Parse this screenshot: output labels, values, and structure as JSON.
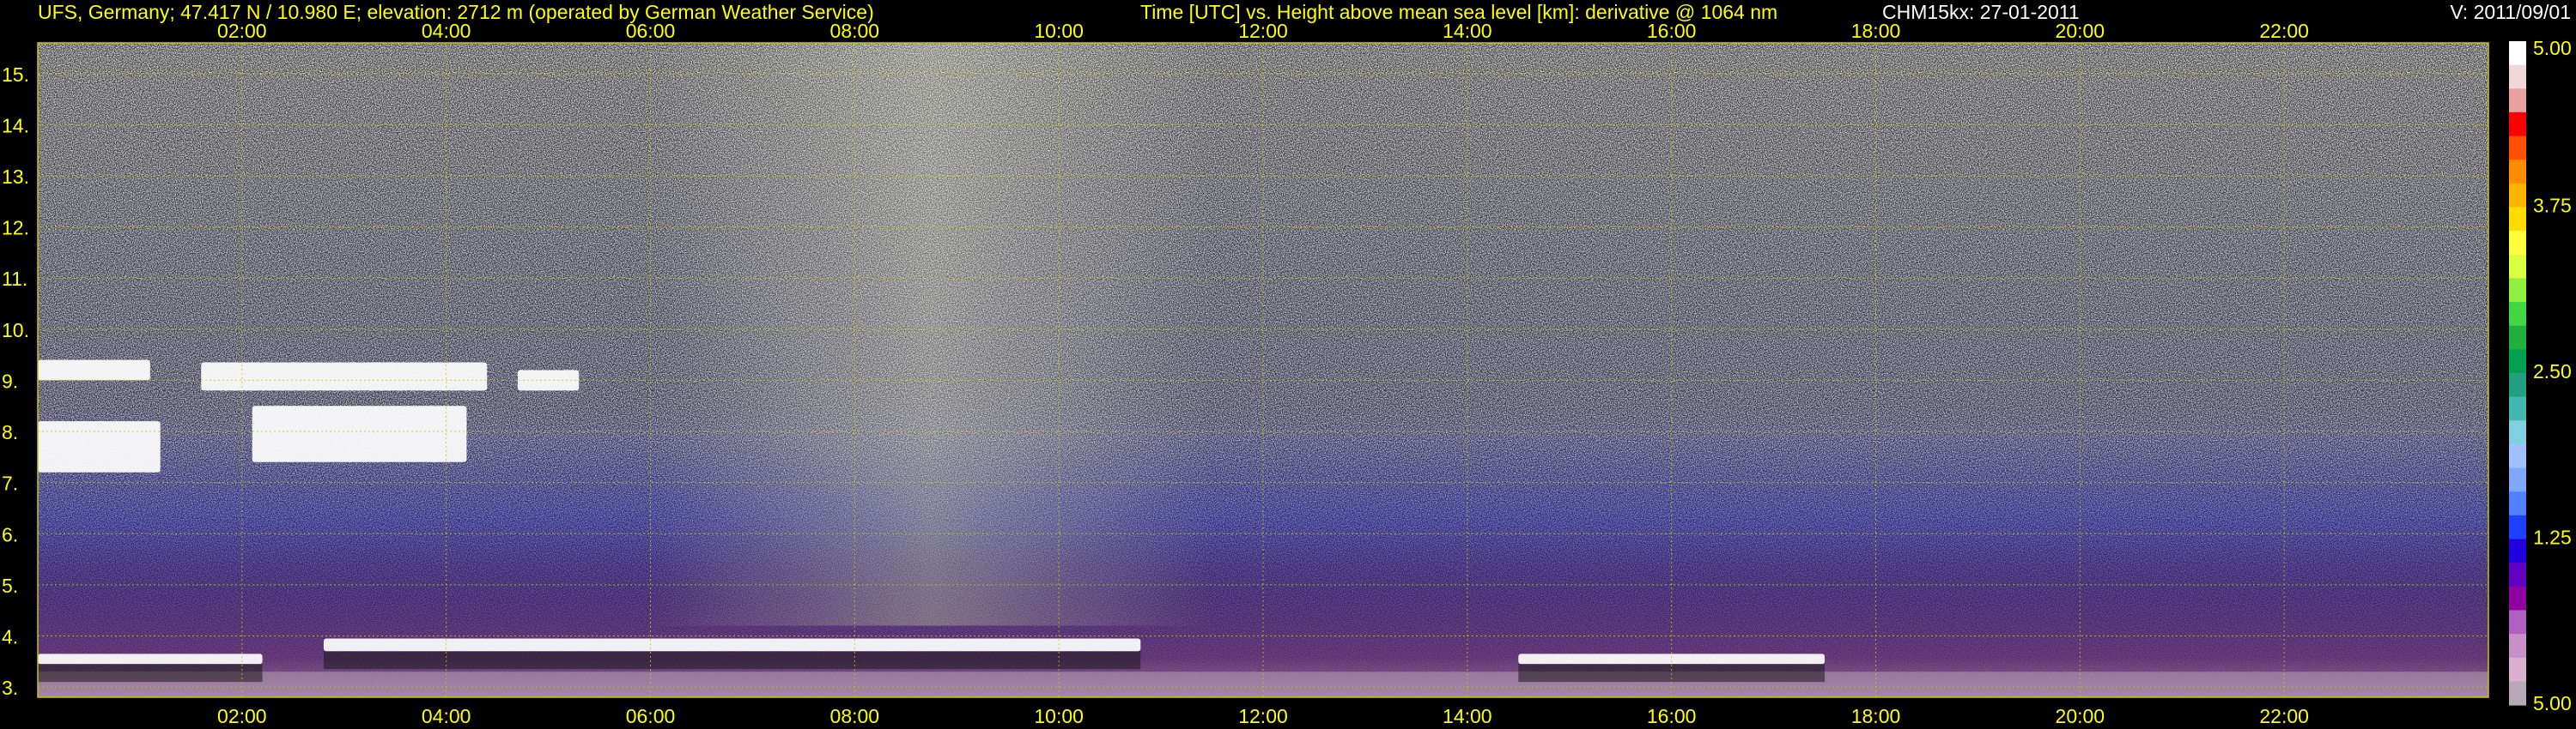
{
  "header": {
    "station": "UFS, Germany; 47.417 N / 10.980 E; elevation: 2712 m  (operated by German Weather Service)",
    "title": "Time [UTC] vs. Height above mean sea level [km]: derivative @ 1064 nm",
    "instrument_date": "CHM15kx: 27-01-2011",
    "version": "V: 2011/09/01"
  },
  "colors": {
    "axis_text": "#ffff00",
    "grid": "#c8c800",
    "frame": "#c8c800",
    "background": "#000000"
  },
  "chart_data": {
    "type": "heatmap",
    "title": "Time [UTC] vs. Height above mean sea level [km]: derivative @ 1064 nm",
    "xlabel": "Time [UTC]",
    "ylabel": "Height above mean sea level [km]",
    "x_unit": "hours UTC",
    "xlim": [
      0,
      24
    ],
    "ylim": [
      2.8,
      15.6
    ],
    "x_ticks": [
      2,
      4,
      6,
      8,
      10,
      12,
      14,
      16,
      18,
      20,
      22
    ],
    "x_tick_labels": [
      "02:00",
      "04:00",
      "06:00",
      "08:00",
      "10:00",
      "12:00",
      "14:00",
      "16:00",
      "18:00",
      "20:00",
      "22:00"
    ],
    "y_ticks": [
      3,
      4,
      5,
      6,
      7,
      8,
      9,
      10,
      11,
      12,
      13,
      14,
      15
    ],
    "y_tick_labels": [
      "3.",
      "4.",
      "5.",
      "6.",
      "7.",
      "8.",
      "9.",
      "10.",
      "11.",
      "12.",
      "13.",
      "14.",
      "15."
    ],
    "grid": true,
    "colorbar": {
      "ticks": [
        5.0,
        3.75,
        2.5,
        1.25,
        5.0
      ],
      "tick_labels": [
        "5.00",
        "3.75",
        "2.50",
        "1.25",
        "5.00"
      ],
      "colors": [
        "#ffffff",
        "#f0d8d8",
        "#e8a0a0",
        "#ff0000",
        "#ff5000",
        "#ff8c00",
        "#ffb400",
        "#ffdc00",
        "#ffff40",
        "#d8ff40",
        "#90f040",
        "#40d840",
        "#20b040",
        "#00a050",
        "#20a080",
        "#40b8b0",
        "#80d0e0",
        "#a0c0ff",
        "#80a8ff",
        "#5080ff",
        "#2040ff",
        "#2000e0",
        "#6000c0",
        "#9000a0",
        "#b060c0",
        "#c890c8",
        "#d8b0d0",
        "#b8a8b8"
      ]
    },
    "noise_field": [
      {
        "x_start": 0,
        "x_end": 24,
        "y_start": 7.0,
        "y_end": 15.6,
        "description_level": "background"
      }
    ],
    "features": [
      {
        "type": "cloud_layer",
        "time_start": 0.0,
        "time_end": 2.2,
        "height_bottom": 3.45,
        "height_top": 3.65
      },
      {
        "type": "cloud_layer",
        "time_start": 2.8,
        "time_end": 10.8,
        "height_bottom": 3.7,
        "height_top": 3.95
      },
      {
        "type": "cloud_layer",
        "time_start": 14.5,
        "time_end": 17.5,
        "height_bottom": 3.45,
        "height_top": 3.65
      },
      {
        "type": "cloud_layer",
        "time_start": 0.0,
        "time_end": 1.2,
        "height_bottom": 7.2,
        "height_top": 8.2
      },
      {
        "type": "cloud_layer",
        "time_start": 0.0,
        "time_end": 1.1,
        "height_bottom": 9.0,
        "height_top": 9.4
      },
      {
        "type": "cloud_layer",
        "time_start": 1.6,
        "time_end": 4.4,
        "height_bottom": 8.8,
        "height_top": 9.35
      },
      {
        "type": "cloud_layer",
        "time_start": 2.1,
        "time_end": 4.2,
        "height_bottom": 7.4,
        "height_top": 8.5
      },
      {
        "type": "cloud_layer",
        "time_start": 4.7,
        "time_end": 5.3,
        "height_bottom": 8.8,
        "height_top": 9.2
      }
    ]
  }
}
